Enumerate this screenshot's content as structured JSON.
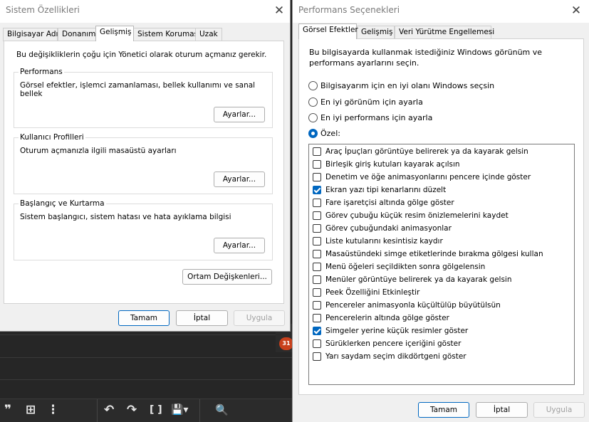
{
  "left_window": {
    "title": "Sistem Özellikleri",
    "close_glyph": "✕",
    "tabs": [
      "Bilgisayar Adı",
      "Donanım",
      "Gelişmiş",
      "Sistem Koruması",
      "Uzak"
    ],
    "admin_note": "Bu değişikliklerin çoğu için Yönetici olarak oturum açmanız gerekir.",
    "groups": [
      {
        "title": "Performans",
        "desc": "Görsel efektler, işlemci zamanlaması, bellek kullanımı ve sanal bellek",
        "button": "Ayarlar..."
      },
      {
        "title": "Kullanıcı Profilleri",
        "desc": "Oturum açmanızla ilgili masaüstü ayarları",
        "button": "Ayarlar..."
      },
      {
        "title": "Başlangıç ve Kurtarma",
        "desc": "Sistem başlangıcı, sistem hatası ve hata ayıklama bilgisi",
        "button": "Ayarlar..."
      }
    ],
    "env_button": "Ortam Değişkenleri...",
    "ok": "Tamam",
    "cancel": "İptal",
    "apply": "Uygula"
  },
  "right_window": {
    "title": "Performans Seçenekleri",
    "close_glyph": "✕",
    "tabs": [
      "Görsel Efektler",
      "Gelişmiş",
      "Veri Yürütme Engellemesi"
    ],
    "intro": [
      "Bu bilgisayarda kullanmak istediğiniz Windows görünüm ve",
      "performans ayarlarını seçin."
    ],
    "radios": [
      {
        "label": "Bilgisayarım için en iyi olanı Windows seçsin",
        "selected": false
      },
      {
        "label": "En iyi görünüm için ayarla",
        "selected": false
      },
      {
        "label": "En iyi performans için ayarla",
        "selected": false
      },
      {
        "label": "Özel:",
        "selected": true
      }
    ],
    "options": [
      {
        "label": "Araç İpuçları görüntüye belirerek ya da kayarak gelsin",
        "checked": false
      },
      {
        "label": "Birleşik giriş kutuları kayarak açılsın",
        "checked": false
      },
      {
        "label": "Denetim ve öğe animasyonlarını pencere içinde göster",
        "checked": false
      },
      {
        "label": "Ekran yazı tipi kenarlarını düzelt",
        "checked": true
      },
      {
        "label": "Fare işaretçisi altında gölge göster",
        "checked": false
      },
      {
        "label": "Görev çubuğu küçük resim önizlemelerini kaydet",
        "checked": false
      },
      {
        "label": "Görev çubuğundaki animasyonlar",
        "checked": false
      },
      {
        "label": "Liste kutularını kesintisiz kaydır",
        "checked": false
      },
      {
        "label": "Masaüstündeki simge etiketlerinde bırakma gölgesi kullan",
        "checked": false
      },
      {
        "label": "Menü öğeleri seçildikten sonra gölgelensin",
        "checked": false
      },
      {
        "label": "Menüler görüntüye belirerek ya da kayarak gelsin",
        "checked": false
      },
      {
        "label": "Peek Özelliğini Etkinleştir",
        "checked": false
      },
      {
        "label": "Pencereler animasyonla küçültülüp büyütülsün",
        "checked": false
      },
      {
        "label": "Pencerelerin altında gölge göster",
        "checked": false
      },
      {
        "label": "Simgeler yerine küçük resimler göster",
        "checked": true
      },
      {
        "label": "Sürüklerken pencere içeriğini göster",
        "checked": false
      },
      {
        "label": "Yarı saydam seçim dikdörtgeni göster",
        "checked": false
      }
    ],
    "ok": "Tamam",
    "cancel": "İptal",
    "apply": "Uygula"
  },
  "background": {
    "badge": "31",
    "toolbar_icons": [
      "❞",
      "⊞",
      "⋮",
      "↶",
      "↷",
      "[ ]",
      "💾▾",
      "🔍"
    ]
  }
}
